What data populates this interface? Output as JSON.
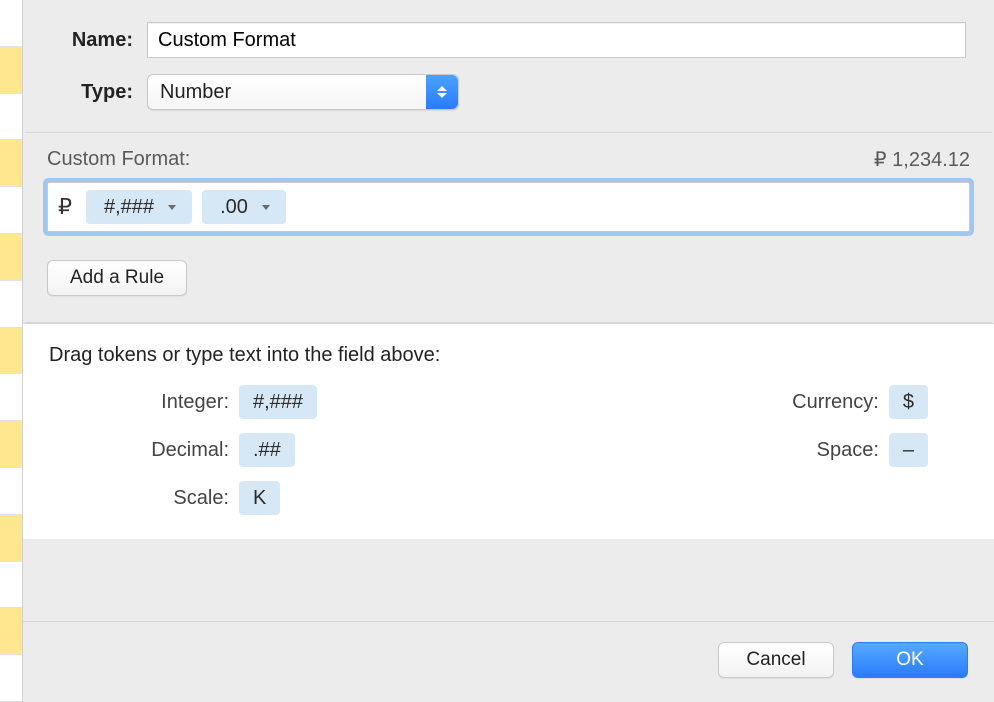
{
  "form": {
    "name_label": "Name:",
    "name_value": "Custom Format",
    "type_label": "Type:",
    "type_selected": "Number"
  },
  "custom_format": {
    "heading": "Custom Format:",
    "preview": "₽ 1,234.12",
    "field_prefix": "₽",
    "tokens": [
      {
        "text": "#,###",
        "has_menu": true
      },
      {
        "text": ".00",
        "has_menu": true
      }
    ],
    "add_rule_label": "Add a Rule"
  },
  "palette": {
    "instruction": "Drag tokens or type text into the field above:",
    "left": [
      {
        "label": "Integer:",
        "token": "#,###"
      },
      {
        "label": "Decimal:",
        "token": ".##"
      },
      {
        "label": "Scale:",
        "token": "K"
      }
    ],
    "right": [
      {
        "label": "Currency:",
        "token": "$"
      },
      {
        "label": "Space:",
        "token": "–"
      }
    ]
  },
  "buttons": {
    "cancel": "Cancel",
    "ok": "OK"
  }
}
